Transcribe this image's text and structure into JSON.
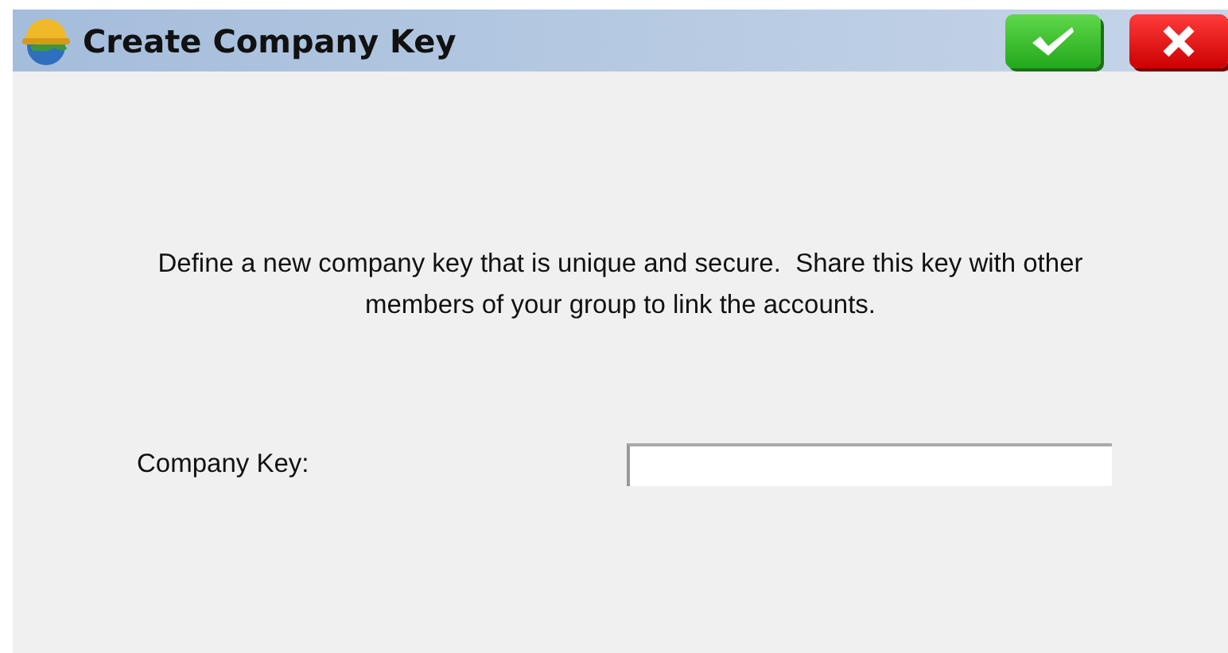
{
  "window": {
    "title": "Create Company Key"
  },
  "description": "Define a new company key that is unique and secure.  Share this key with other members of your group to link the accounts.",
  "fields": [
    {
      "label": "Company Key:"
    }
  ]
}
